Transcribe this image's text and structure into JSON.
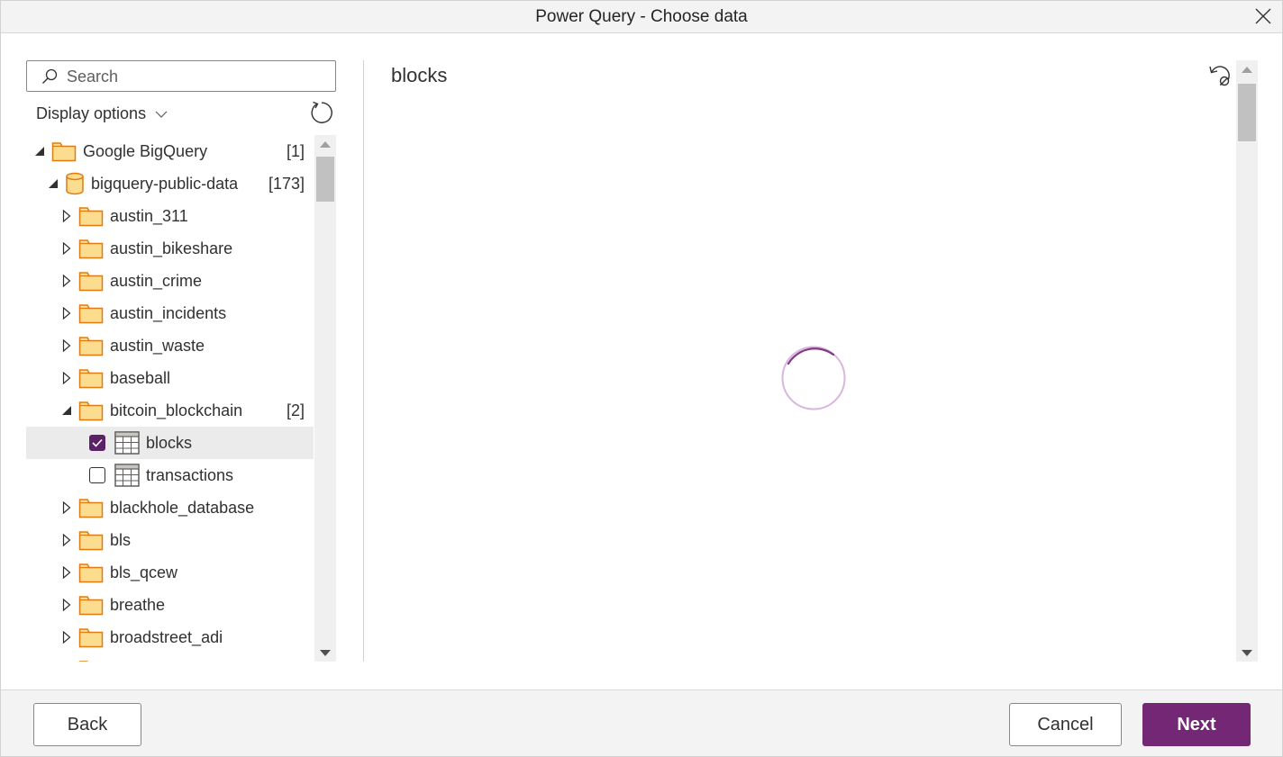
{
  "window": {
    "title": "Power Query - Choose data"
  },
  "navigator": {
    "search_placeholder": "Search",
    "display_options_label": "Display options",
    "tree": [
      {
        "label": "Google BigQuery",
        "count": "[1]",
        "level": 0,
        "type": "folder",
        "state": "expanded"
      },
      {
        "label": "bigquery-public-data",
        "count": "[173]",
        "level": 1,
        "type": "database",
        "state": "expanded"
      },
      {
        "label": "austin_311",
        "count": "",
        "level": 2,
        "type": "folder",
        "state": "collapsed"
      },
      {
        "label": "austin_bikeshare",
        "count": "",
        "level": 2,
        "type": "folder",
        "state": "collapsed"
      },
      {
        "label": "austin_crime",
        "count": "",
        "level": 2,
        "type": "folder",
        "state": "collapsed"
      },
      {
        "label": "austin_incidents",
        "count": "",
        "level": 2,
        "type": "folder",
        "state": "collapsed"
      },
      {
        "label": "austin_waste",
        "count": "",
        "level": 2,
        "type": "folder",
        "state": "collapsed"
      },
      {
        "label": "baseball",
        "count": "",
        "level": 2,
        "type": "folder",
        "state": "collapsed"
      },
      {
        "label": "bitcoin_blockchain",
        "count": "[2]",
        "level": 2,
        "type": "folder",
        "state": "expanded"
      },
      {
        "label": "blocks",
        "count": "",
        "level": 3,
        "type": "table",
        "checked": true,
        "selected": true
      },
      {
        "label": "transactions",
        "count": "",
        "level": 3,
        "type": "table",
        "checked": false
      },
      {
        "label": "blackhole_database",
        "count": "",
        "level": 2,
        "type": "folder",
        "state": "collapsed"
      },
      {
        "label": "bls",
        "count": "",
        "level": 2,
        "type": "folder",
        "state": "collapsed"
      },
      {
        "label": "bls_qcew",
        "count": "",
        "level": 2,
        "type": "folder",
        "state": "collapsed"
      },
      {
        "label": "breathe",
        "count": "",
        "level": 2,
        "type": "folder",
        "state": "collapsed"
      },
      {
        "label": "broadstreet_adi",
        "count": "",
        "level": 2,
        "type": "folder",
        "state": "collapsed"
      }
    ]
  },
  "preview": {
    "title": "blocks",
    "status": "loading"
  },
  "footer": {
    "back_label": "Back",
    "cancel_label": "Cancel",
    "next_label": "Next"
  },
  "colors": {
    "accent": "#742774",
    "checkbox_checked": "#5c2268",
    "folder_fill": "#fcdc8f",
    "folder_stroke": "#e07b12",
    "spinner_track": "#d9b6dd",
    "spinner_head": "#742774"
  }
}
